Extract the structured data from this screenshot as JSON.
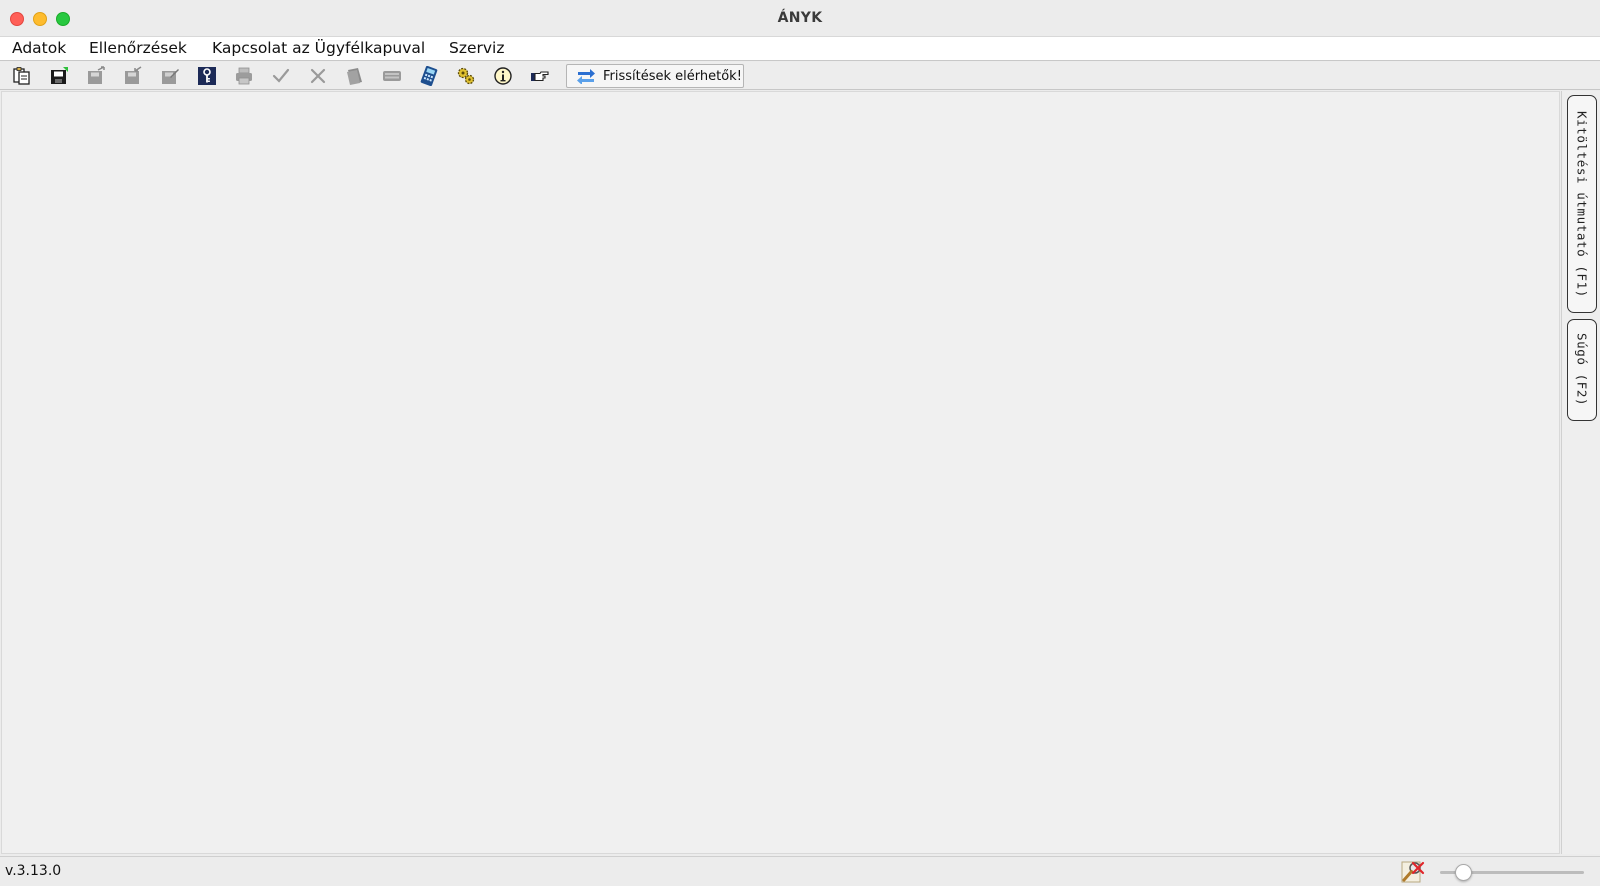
{
  "window": {
    "title": "ÁNYK"
  },
  "menubar": {
    "items": [
      {
        "label": "Adatok"
      },
      {
        "label": "Ellenőrzések"
      },
      {
        "label": "Kapcsolat az Ügyfélkapuval"
      },
      {
        "label": "Szerviz"
      }
    ]
  },
  "toolbar": {
    "icons": [
      {
        "icon": "copy-documents-icon",
        "enabled": true
      },
      {
        "icon": "save-icon",
        "enabled": true
      },
      {
        "icon": "export-icon",
        "enabled": false
      },
      {
        "icon": "import-icon",
        "enabled": false
      },
      {
        "icon": "edit-form-icon",
        "enabled": false
      },
      {
        "icon": "key-icon",
        "enabled": true
      },
      {
        "icon": "print-icon",
        "enabled": false
      },
      {
        "icon": "check-icon",
        "enabled": false
      },
      {
        "icon": "cross-icon",
        "enabled": false
      },
      {
        "icon": "document-stack-icon",
        "enabled": false
      },
      {
        "icon": "keyboard-icon",
        "enabled": false
      },
      {
        "icon": "calculator-icon",
        "enabled": true
      },
      {
        "icon": "gears-icon",
        "enabled": true
      },
      {
        "icon": "info-icon",
        "enabled": true
      },
      {
        "icon": "pointing-hand-icon",
        "enabled": true
      }
    ],
    "update_button": {
      "icon": "refresh-arrows-icon",
      "label": "Frissítések elérhetők!"
    }
  },
  "side_panel": {
    "tabs": [
      {
        "label": "Kitöltési útmutató (F1)"
      },
      {
        "label": "Súgó (F2)"
      }
    ]
  },
  "statusbar": {
    "version": "v.3.13.0",
    "tool_icon": "magnifier-disabled-icon",
    "zoom_slider": 0.12
  },
  "colors": {
    "accent": "#1f6fd1",
    "disabled_icon": "#9a9a9a",
    "window_bg": "#ececec",
    "content_bg": "#f0f0f0"
  }
}
